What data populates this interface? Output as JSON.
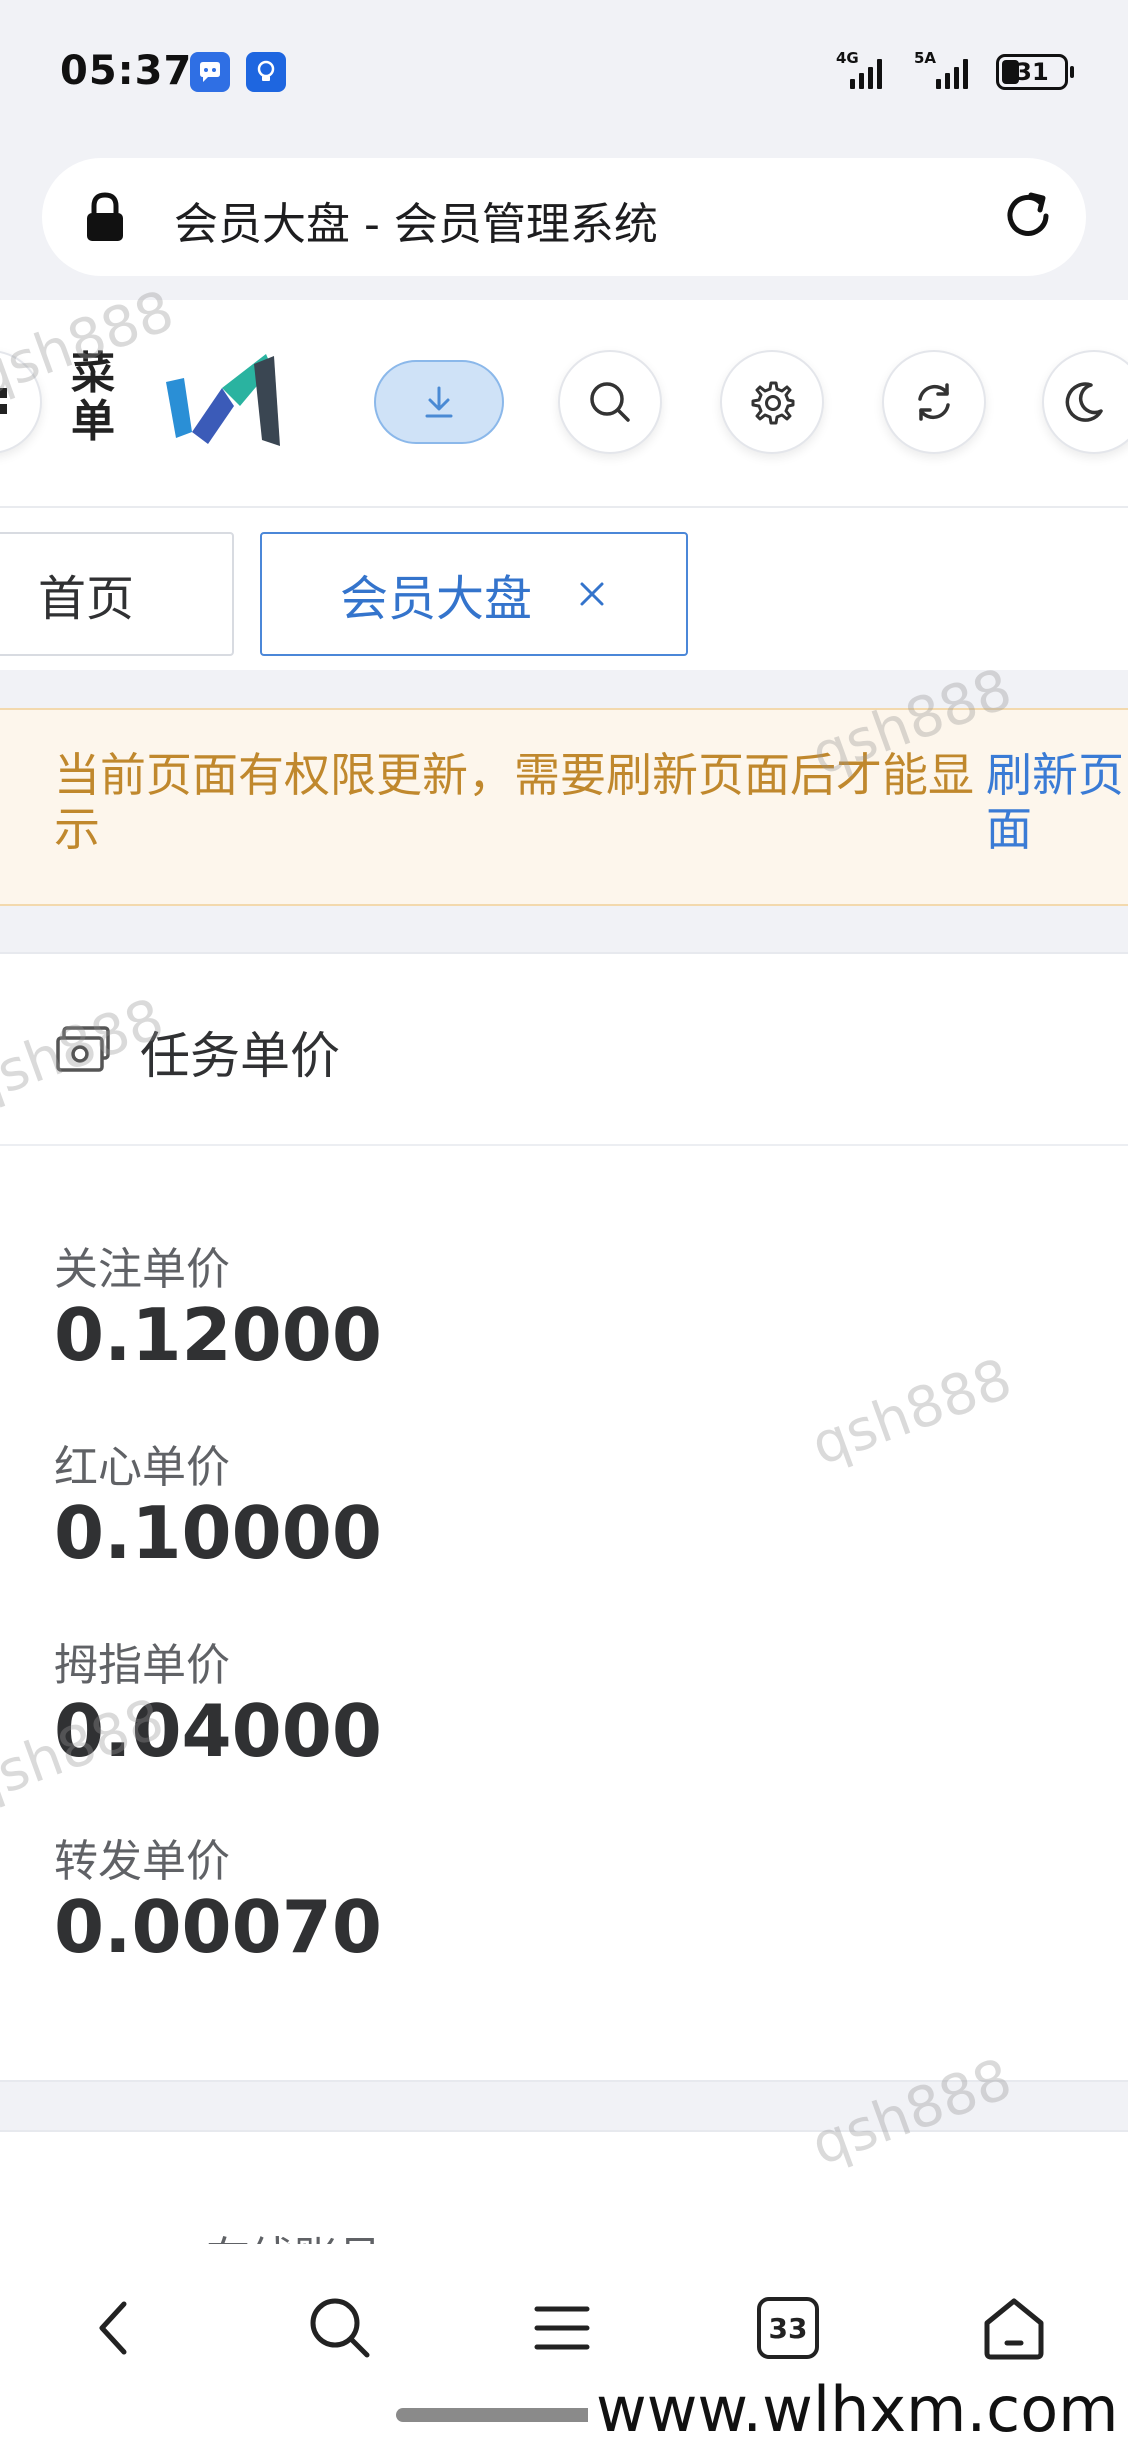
{
  "status_bar": {
    "time": "05:37",
    "notification_icons": [
      "chat-bubble-icon",
      "bulb-icon"
    ],
    "network_1": "4G",
    "network_2": "5A",
    "battery_level": "31"
  },
  "browser": {
    "page_title": "会员大盘 - 会员管理系统"
  },
  "header": {
    "menu_label": "菜单",
    "actions": [
      "download-icon",
      "search-icon",
      "gear-icon",
      "refresh-icon",
      "moon-icon"
    ]
  },
  "tabs": [
    {
      "label": "首页",
      "active": false
    },
    {
      "label": "会员大盘",
      "active": true
    }
  ],
  "alert": {
    "message": "当前页面有权限更新，需要刷新页面后才能显示",
    "action": "刷新页面"
  },
  "price_card": {
    "title": "任务单价",
    "items": [
      {
        "label": "关注单价",
        "value": "0.12000"
      },
      {
        "label": "红心单价",
        "value": "0.10000"
      },
      {
        "label": "拇指单价",
        "value": "0.04000"
      },
      {
        "label": "转发单价",
        "value": "0.00070"
      }
    ]
  },
  "next_card": {
    "title": "在线账号"
  },
  "toolbar": {
    "tab_count": "33"
  },
  "watermark": "qsh888",
  "site_mark": "www.wlhxm.com",
  "colors": {
    "accent": "#3474cc",
    "warning_text": "#c0882d",
    "warning_bg": "#fdf6ec"
  }
}
